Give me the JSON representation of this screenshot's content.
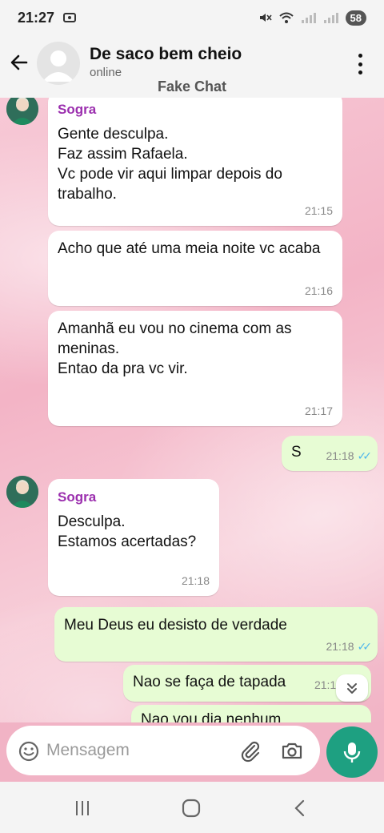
{
  "status_bar": {
    "time": "21:27",
    "battery": "58"
  },
  "header": {
    "contact_name": "De saco bem cheio",
    "contact_status": "online",
    "watermark": "Fake Chat"
  },
  "messages": [
    {
      "sender": "Sogra",
      "text": "Gente desculpa.\nFaz assim Rafaela.\nVc pode vir aqui limpar depois do trabalho.",
      "time": "21:15"
    },
    {
      "text": "Acho que até uma meia noite vc acaba",
      "time": "21:16"
    },
    {
      "text": "Amanhã eu vou no cinema com as meninas.\nEntao da pra vc vir.",
      "time": "21:17"
    },
    {
      "text": "S",
      "time": "21:18"
    },
    {
      "sender": "Sogra",
      "text": "Desculpa.\nEstamos acertadas?",
      "time": "21:18"
    },
    {
      "text": "Meu Deus eu desisto de verdade",
      "time": "21:18"
    },
    {
      "text": "Nao se faça de tapada",
      "time": "21:19"
    },
    {
      "text": "Nao vou dia nenhum"
    }
  ],
  "input": {
    "placeholder": "Mensagem"
  },
  "colors": {
    "accent": "#1ea081",
    "sender_name": "#9b2fae",
    "outgoing_bubble": "#e7fcd4",
    "read_ticks": "#4fb6ec"
  },
  "icons": [
    "back-arrow-icon",
    "more-vert-icon",
    "emoji-icon",
    "attach-icon",
    "camera-icon",
    "mic-icon",
    "chevron-down-icon",
    "recent-apps-icon",
    "home-icon",
    "nav-back-icon"
  ]
}
